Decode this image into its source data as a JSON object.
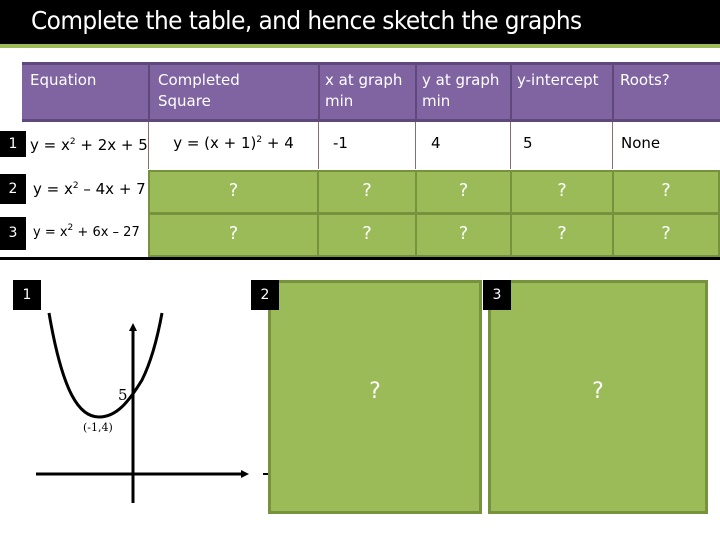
{
  "title": "Complete the table, and hence sketch the graphs",
  "table": {
    "headers": [
      {
        "line1": "Equation",
        "line2": ""
      },
      {
        "line1": "Completed",
        "line2": "Square"
      },
      {
        "line1": "x at graph",
        "line2": "min"
      },
      {
        "line1": "y at graph",
        "line2": "min"
      },
      {
        "line1": "y-intercept",
        "line2": ""
      },
      {
        "line1": "Roots?",
        "line2": ""
      }
    ],
    "rows": [
      {
        "number": "1",
        "equation": {
          "pre": "y = x",
          "exp": "2",
          "post": " + 2x + 5"
        },
        "completed_square": {
          "pre": "y = (x + 1)",
          "exp": "2",
          "post": " + 4"
        },
        "x_min": "-1",
        "y_min": "4",
        "y_intercept": "5",
        "roots": "None"
      },
      {
        "number": "2",
        "equation": {
          "pre": "y = x",
          "exp": "2",
          "post": " – 4x + 7"
        },
        "completed_square": "?",
        "x_min": "?",
        "y_min": "?",
        "y_intercept": "?",
        "roots": "?"
      },
      {
        "number": "3",
        "equation": {
          "pre": "y = x",
          "exp": "2",
          "post": " + 6x – 27"
        },
        "completed_square": "?",
        "x_min": "?",
        "y_min": "?",
        "y_intercept": "?",
        "roots": "?"
      }
    ]
  },
  "graphs": [
    {
      "number": "1",
      "intercept_label": "5",
      "min_label": "(-1,4)"
    },
    {
      "number": "2",
      "placeholder": "?"
    },
    {
      "number": "3",
      "placeholder": "?"
    }
  ],
  "colors": {
    "header_purple": "#8064a2",
    "answer_green": "#9bbb59",
    "green_border": "#76923c"
  }
}
